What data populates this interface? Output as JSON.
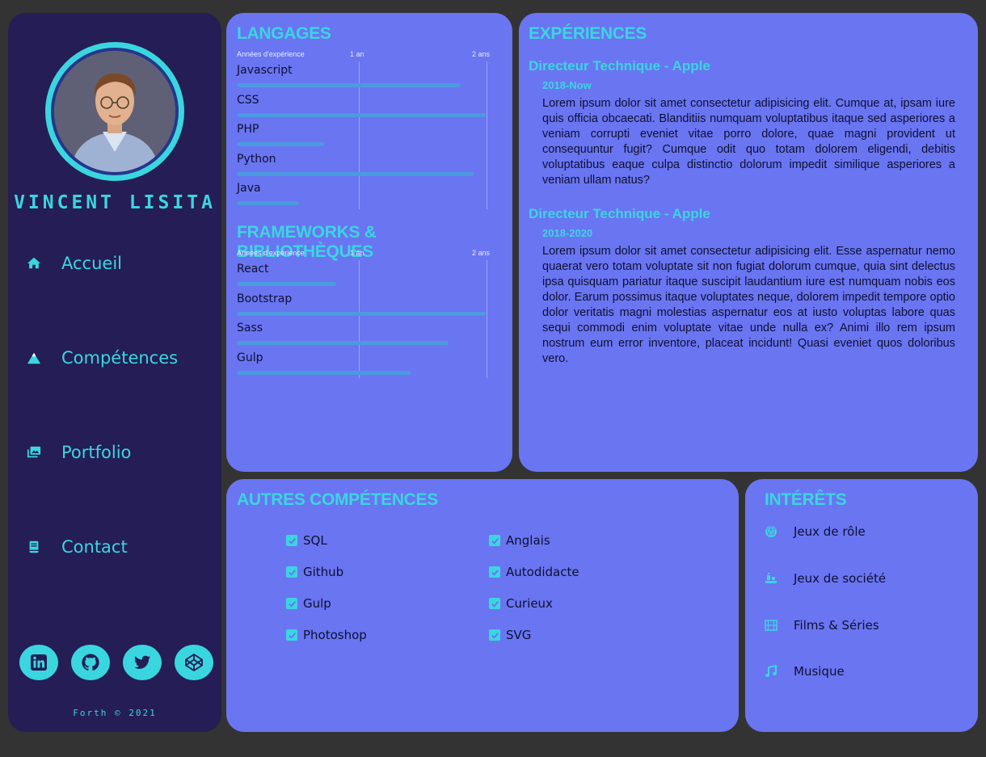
{
  "profile": {
    "name": "VINCENT LISITA",
    "avatar_alt": "Photo de profil"
  },
  "nav": [
    {
      "label": "Accueil",
      "icon": "home-icon"
    },
    {
      "label": "Compétences",
      "icon": "mountain-icon"
    },
    {
      "label": "Portfolio",
      "icon": "images-icon"
    },
    {
      "label": "Contact",
      "icon": "book-icon"
    }
  ],
  "socials": [
    {
      "icon": "linkedin-icon"
    },
    {
      "icon": "github-icon"
    },
    {
      "icon": "twitter-icon"
    },
    {
      "icon": "codepen-icon"
    }
  ],
  "footer": "Forth © 2021",
  "languages": {
    "title": "LANGAGES",
    "scale": {
      "label": "Années d'expérience",
      "mid": "1 an",
      "max": "2 ans"
    },
    "items": [
      {
        "name": "Javascript",
        "level": 0.9
      },
      {
        "name": "CSS",
        "level": 1.0
      },
      {
        "name": "PHP",
        "level": 0.35
      },
      {
        "name": "Python",
        "level": 0.95
      },
      {
        "name": "Java",
        "level": 0.25
      }
    ]
  },
  "frameworks": {
    "title": "FRAMEWORKS & BIBLIOTHÈQUES",
    "scale": {
      "label": "Années d'expérience",
      "mid": "1 an",
      "max": "2 ans"
    },
    "items": [
      {
        "name": "React",
        "level": 0.4
      },
      {
        "name": "Bootstrap",
        "level": 1.0
      },
      {
        "name": "Sass",
        "level": 0.85
      },
      {
        "name": "Gulp",
        "level": 0.7
      }
    ]
  },
  "experiences": {
    "title": "EXPÉRIENCES",
    "jobs": [
      {
        "title": "Directeur Technique - Apple",
        "date": "2018-Now",
        "description": "Lorem ipsum dolor sit amet consectetur adipisicing elit. Cumque at, ipsam iure quis officia obcaecati. Blanditiis numquam voluptatibus itaque sed asperiores a veniam corrupti eveniet vitae porro dolore, quae magni provident ut consequuntur fugit? Cumque odit quo totam dolorem eligendi, debitis voluptatibus eaque culpa distinctio dolorum impedit similique asperiores a veniam ullam natus?"
      },
      {
        "title": "Directeur Technique - Apple",
        "date": "2018-2020",
        "description": "Lorem ipsum dolor sit amet consectetur adipisicing elit. Esse aspernatur nemo quaerat vero totam voluptate sit non fugiat dolorum cumque, quia sint delectus ipsa quisquam pariatur itaque suscipit laudantium iure est numquam nobis eos dolor. Earum possimus itaque voluptates neque, dolorem impedit tempore optio dolor veritatis magni molestias aspernatur eos at iusto voluptas labore quas sequi commodi enim voluptate vitae unde nulla ex? Animi illo rem ipsum nostrum eum error inventore, placeat incidunt! Quasi eveniet quos doloribus vero."
      }
    ]
  },
  "other_skills": {
    "title": "AUTRES COMPÉTENCES",
    "left": [
      "SQL",
      "Github",
      "Gulp",
      "Photoshop"
    ],
    "right": [
      "Anglais",
      "Autodidacte",
      "Curieux",
      "SVG"
    ]
  },
  "interests": {
    "title": "INTÉRÊTS",
    "items": [
      {
        "label": "Jeux de rôle",
        "icon": "dice-icon"
      },
      {
        "label": "Jeux de société",
        "icon": "chess-icon"
      },
      {
        "label": "Films & Séries",
        "icon": "film-icon"
      },
      {
        "label": "Musique",
        "icon": "music-icon"
      }
    ]
  },
  "colors": {
    "accent": "#3ad6df",
    "card": "#6a75f2",
    "sidebar": "#251d55",
    "background": "#333333",
    "bar": "#4c9ae0"
  }
}
